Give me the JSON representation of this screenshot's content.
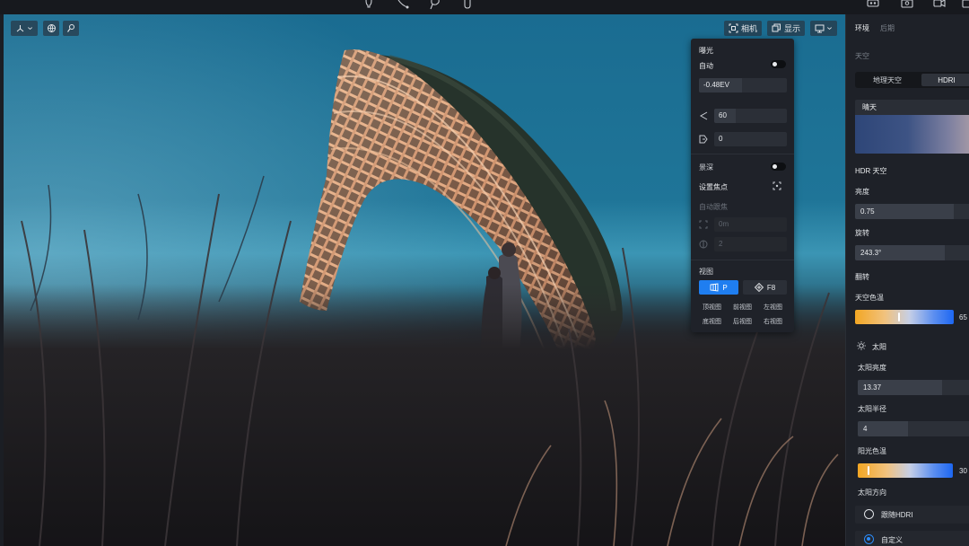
{
  "top_toolbar": {
    "icons": [
      "bulb-icon",
      "spline-icon",
      "lasso-icon",
      "hand-pointer-icon",
      "vr-headset-icon",
      "camera-snapshot-icon",
      "video-camera-icon",
      "export-icon"
    ]
  },
  "viewport": {
    "left_tools": [
      "axis-gizmo-icon",
      "globe-icon",
      "magic-wand-icon"
    ],
    "camera_btn": "相机",
    "display_btn": "显示"
  },
  "camera_panel": {
    "exposure_title": "曝光",
    "auto_label": "自动",
    "auto_exposure_on": false,
    "ev_value": "-0.48EV",
    "fov_value": "60",
    "tilt_value": "0",
    "dof_label": "景深",
    "dof_on": false,
    "set_focus_label": "设置焦点",
    "auto_follow_label": "自动跟焦",
    "focus_distance": "0m",
    "aperture": "2",
    "view_title": "视图",
    "view_mode": "P",
    "f8_label": "F8",
    "views": [
      "顶视图",
      "前视图",
      "左视图",
      "底视图",
      "后视图",
      "右视图"
    ]
  },
  "right_panel": {
    "tabs": [
      "环境",
      "后期"
    ],
    "sky_title": "天空",
    "sky_modes": [
      "地理天空",
      "HDRI"
    ],
    "hdri_name": "晴天",
    "hdr_sky_title": "HDR 天空",
    "brightness_label": "亮度",
    "brightness_value": "0.75",
    "rotation_label": "旋转",
    "rotation_value": "243.3°",
    "flip_label": "翻转",
    "sky_temp_label": "天空色温",
    "sky_temp_value": "65",
    "sun_title": "太阳",
    "sun_brightness_label": "太阳亮度",
    "sun_brightness_value": "13.37",
    "sun_radius_label": "太阳半径",
    "sun_radius_value": "4",
    "sunlight_temp_label": "阳光色温",
    "sunlight_temp_value": "30",
    "sun_direction_label": "太阳方向",
    "follow_hdri_label": "跟随HDRI",
    "custom_label": "自定义",
    "selected_direction": "自定义"
  },
  "colors": {
    "accent": "#1f7ef0",
    "panel_bg": "#1e2128",
    "popover_bg": "#1f2229"
  }
}
